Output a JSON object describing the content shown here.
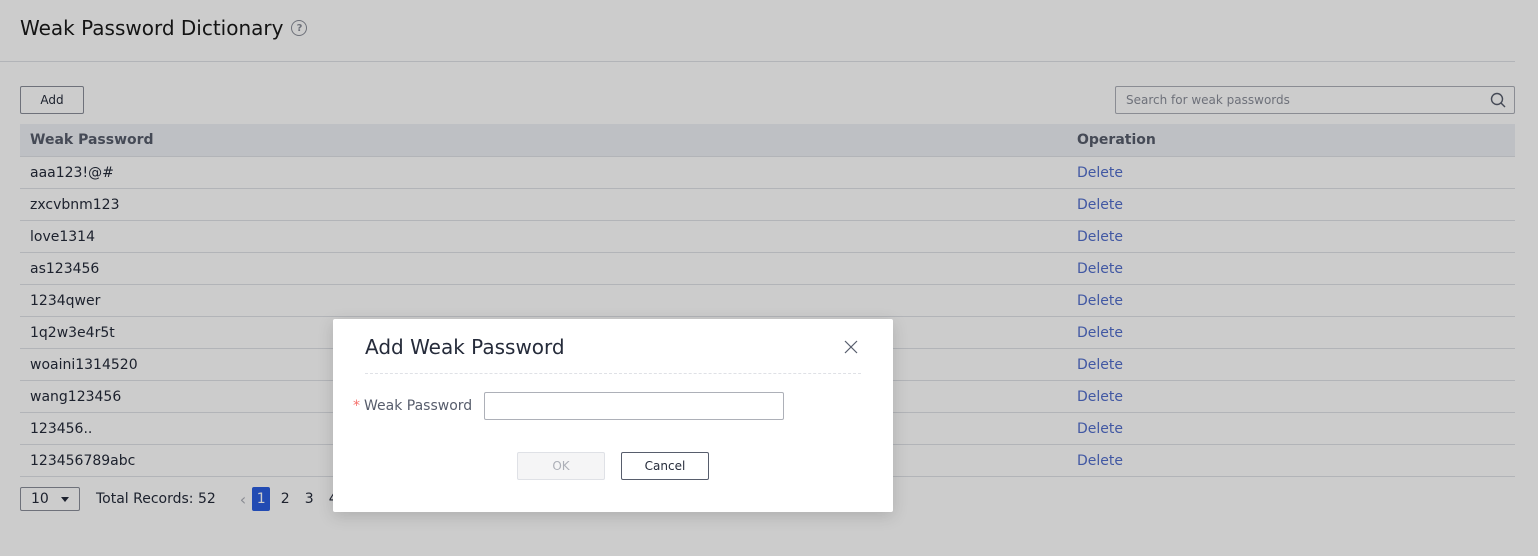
{
  "header": {
    "title": "Weak Password Dictionary"
  },
  "toolbar": {
    "add_label": "Add",
    "search_placeholder": "Search for weak passwords"
  },
  "table": {
    "columns": [
      "Weak Password",
      "Operation"
    ],
    "rows": [
      {
        "password": "aaa123!@#",
        "action": "Delete"
      },
      {
        "password": "zxcvbnm123",
        "action": "Delete"
      },
      {
        "password": "love1314",
        "action": "Delete"
      },
      {
        "password": "as123456",
        "action": "Delete"
      },
      {
        "password": "1234qwer",
        "action": "Delete"
      },
      {
        "password": "1q2w3e4r5t",
        "action": "Delete"
      },
      {
        "password": "woaini1314520",
        "action": "Delete"
      },
      {
        "password": "wang123456",
        "action": "Delete"
      },
      {
        "password": "123456..",
        "action": "Delete"
      },
      {
        "password": "123456789abc",
        "action": "Delete"
      }
    ]
  },
  "pagination": {
    "page_size": "10",
    "total_label": "Total Records: 52",
    "pages": [
      "1",
      "2",
      "3",
      "4"
    ],
    "current_page": "1"
  },
  "dialog": {
    "title": "Add Weak Password",
    "required_mark": "*",
    "field_label": "Weak Password",
    "field_value": "",
    "ok_label": "OK",
    "cancel_label": "Cancel"
  },
  "colors": {
    "link": "#526ecc",
    "active_page": "#2b5ee0",
    "required": "#f66f6a"
  }
}
